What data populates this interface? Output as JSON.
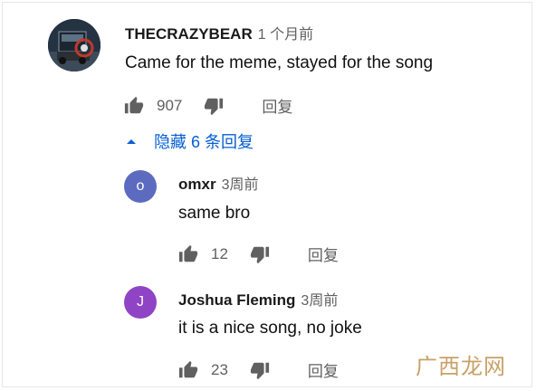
{
  "top_comment": {
    "author": "THECRAZYBEAR",
    "time": "1 个月前",
    "text": "Came for the meme, stayed for the song",
    "likes": "907",
    "reply_label": "回复"
  },
  "replies_toggle": {
    "label": "隐藏 6 条回复",
    "color": "#065fd4"
  },
  "replies": [
    {
      "avatar_letter": "o",
      "avatar_color": "#5c6bc0",
      "author": "omxr",
      "time": "3周前",
      "text": "same bro",
      "likes": "12",
      "reply_label": "回复"
    },
    {
      "avatar_letter": "J",
      "avatar_color": "#8e44c4",
      "author": "Joshua Fleming",
      "time": "3周前",
      "text": "it is a nice song, no joke",
      "likes": "23",
      "reply_label": "回复"
    }
  ],
  "watermark": "广西龙网"
}
